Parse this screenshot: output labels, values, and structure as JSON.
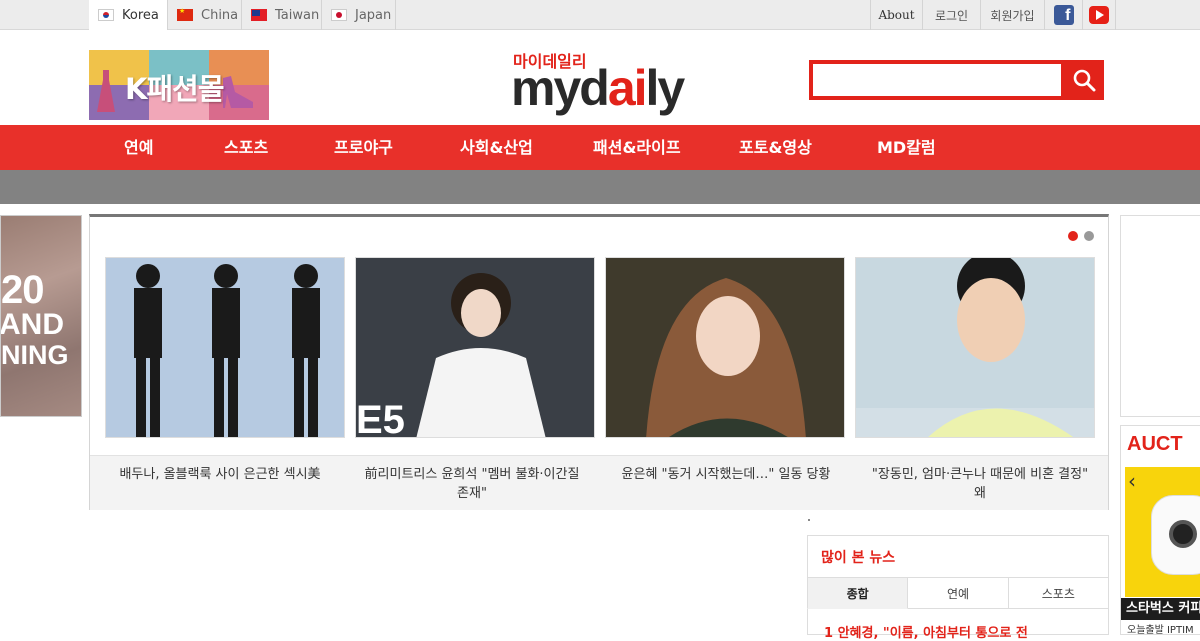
{
  "languages": [
    {
      "label": "Korea",
      "flag": "korea-flag-icon",
      "active": true
    },
    {
      "label": "China",
      "flag": "china-flag-icon",
      "active": false
    },
    {
      "label": "Taiwan",
      "flag": "taiwan-flag-icon",
      "active": false
    },
    {
      "label": "Japan",
      "flag": "japan-flag-icon",
      "active": false
    }
  ],
  "util": {
    "about": "About",
    "login": "로그인",
    "signup": "회원가입",
    "facebook_icon": "facebook-icon",
    "youtube_icon": "youtube-icon"
  },
  "header": {
    "kfashion_label": "K패션몰",
    "logo_kr": "마이데일리",
    "logo_en_main": "myd",
    "logo_en_red": "ai",
    "logo_en_end": "ly",
    "search_value": "",
    "search_icon": "search-icon",
    "accent_color": "#e2231a"
  },
  "nav": [
    "연예",
    "스포츠",
    "프로야구",
    "사회&산업",
    "패션&라이프",
    "포토&영상",
    "MD칼럼"
  ],
  "left_ad": {
    "line1": "20",
    "line2": "AND",
    "line3": "NING"
  },
  "slider": {
    "dots": [
      true,
      false
    ],
    "slides": [
      {
        "caption": "배두나, 올블랙룩 사이 은근한 섹시美"
      },
      {
        "caption": "前리미트리스 윤희석 \"멤버 불화·이간질 존재\""
      },
      {
        "caption": "윤은혜 \"동거 시작했는데…\" 일동 당황"
      },
      {
        "caption": "\"장동민, 엄마·큰누나 때문에 비혼 결정\" 왜"
      }
    ]
  },
  "right_ad": {
    "brand": "AUCT",
    "caption": "스타벅스 커피",
    "sub": "오늘출발 IPTIM"
  },
  "popular": {
    "title": "많이 본 뉴스",
    "tabs": [
      "종합",
      "연예",
      "스포츠"
    ],
    "first_item": "1  안혜경, \"이름, 아침부터 통으로 전"
  }
}
